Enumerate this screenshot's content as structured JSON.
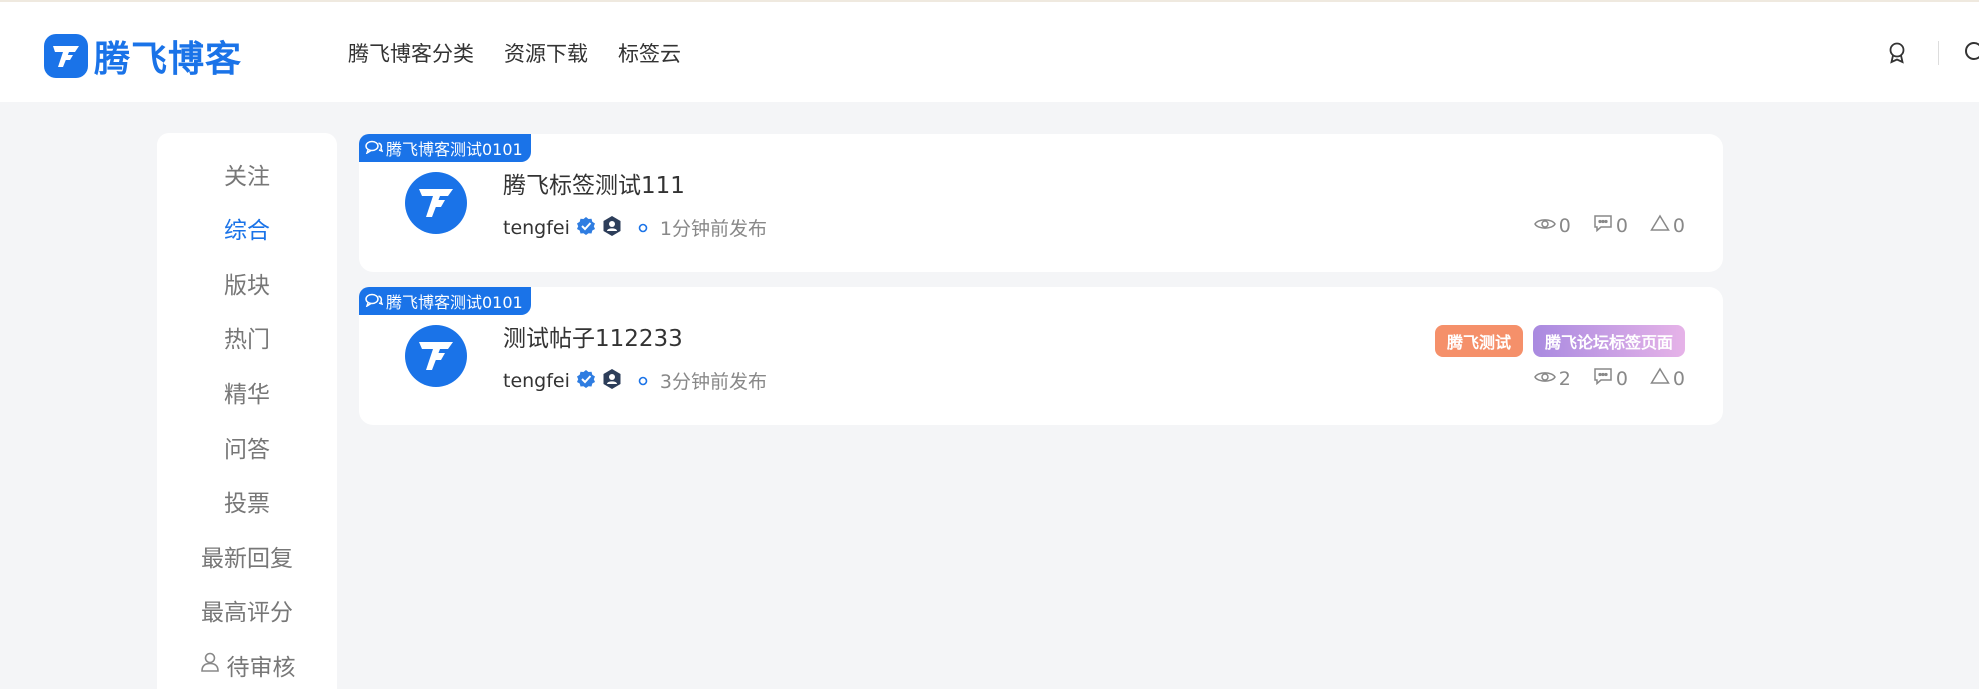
{
  "brand": {
    "name": "腾飞博客",
    "color": "#1a73e8"
  },
  "nav": [
    "腾飞博客分类",
    "资源下载",
    "标签云"
  ],
  "header_icons": [
    "medal-icon",
    "search-icon"
  ],
  "sidebar": {
    "items": [
      {
        "label": "关注",
        "active": false
      },
      {
        "label": "综合",
        "active": true
      },
      {
        "label": "版块",
        "active": false
      },
      {
        "label": "热门",
        "active": false
      },
      {
        "label": "精华",
        "active": false
      },
      {
        "label": "问答",
        "active": false
      },
      {
        "label": "投票",
        "active": false
      },
      {
        "label": "最新回复",
        "active": false
      },
      {
        "label": "最高评分",
        "active": false
      },
      {
        "label": "待审核",
        "active": false,
        "icon": "user-icon"
      }
    ]
  },
  "posts": [
    {
      "section": "腾飞博客测试0101",
      "title": "腾飞标签测试111",
      "author": "tengfei",
      "time": "1分钟前发布",
      "views": "0",
      "comments": "0",
      "likes": "0",
      "tags": []
    },
    {
      "section": "腾飞博客测试0101",
      "title": "测试帖子112233",
      "author": "tengfei",
      "time": "3分钟前发布",
      "views": "2",
      "comments": "0",
      "likes": "0",
      "tags": [
        {
          "label": "腾飞测试",
          "color": "#f5906a"
        },
        {
          "label": "腾飞论坛标签页面",
          "color": "#b991e0"
        }
      ]
    }
  ]
}
